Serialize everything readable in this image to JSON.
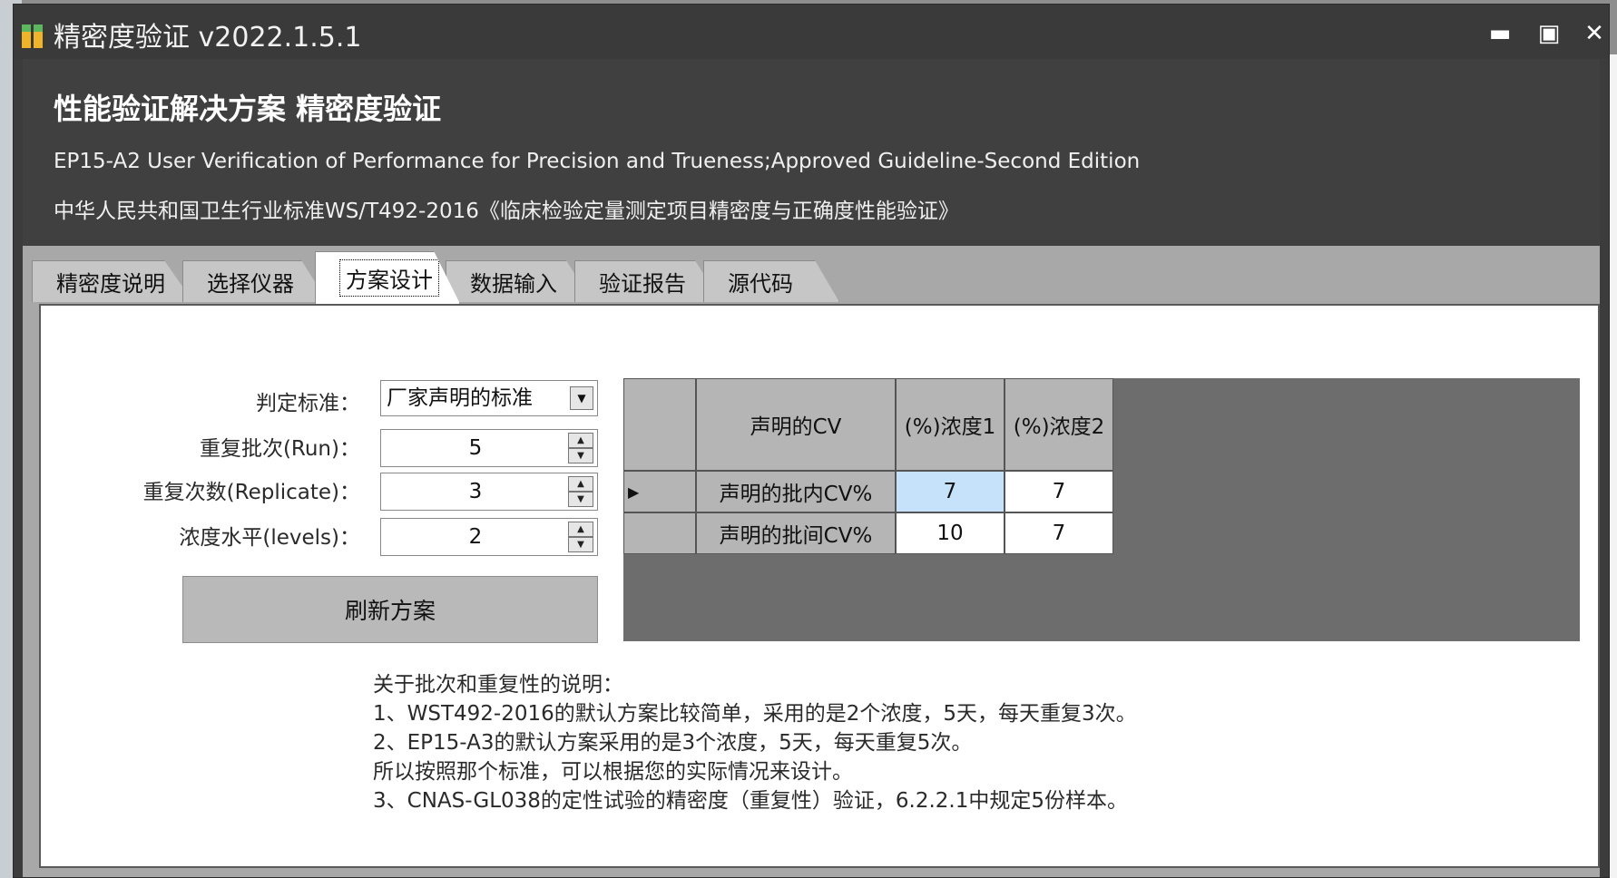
{
  "window": {
    "title": "精密度验证  v2022.1.5.1",
    "controls": {
      "minimize": "▬",
      "maximize": "▣",
      "close": "✕"
    },
    "icon": "app-icon"
  },
  "header": {
    "title": "性能验证解决方案 精密度验证",
    "subtitle_en": "EP15-A2 User Verification of Performance for Precision and Trueness;Approved Guideline-Second Edition",
    "subtitle_cn": "中华人民共和国卫生行业标准WS/T492-2016《临床检验定量测定项目精密度与正确度性能验证》"
  },
  "tabs": [
    {
      "label": "精密度说明"
    },
    {
      "label": "选择仪器"
    },
    {
      "label": "方案设计",
      "active": true
    },
    {
      "label": "数据输入"
    },
    {
      "label": "验证报告"
    },
    {
      "label": "源代码"
    }
  ],
  "form": {
    "criterion_label": "判定标准：",
    "criterion_value": "厂家声明的标准",
    "run_label": "重复批次(Run)：",
    "run_value": "5",
    "replicate_label": "重复次数(Replicate)：",
    "replicate_value": "3",
    "levels_label": "浓度水平(levels)：",
    "levels_value": "2",
    "refresh_label": "刷新方案"
  },
  "grid": {
    "columns": [
      "声明的CV",
      "(%)浓度1",
      "(%)浓度2"
    ],
    "rows": [
      {
        "label": "声明的批内CV%",
        "values": [
          "7",
          "7"
        ],
        "current": true
      },
      {
        "label": "声明的批间CV%",
        "values": [
          "10",
          "7"
        ]
      }
    ],
    "row_indicator": "▶"
  },
  "notes": [
    "关于批次和重复性的说明：",
    "1、WST492-2016的默认方案比较简单，采用的是2个浓度，5天，每天重复3次。",
    "2、EP15-A3的默认方案采用的是3个浓度，5天，每天重复5次。",
    "所以按照那个标准，可以根据您的实际情况来设计。",
    "3、CNAS-GL038的定性试验的精密度（重复性）验证，6.2.2.1中规定5份样本。"
  ]
}
